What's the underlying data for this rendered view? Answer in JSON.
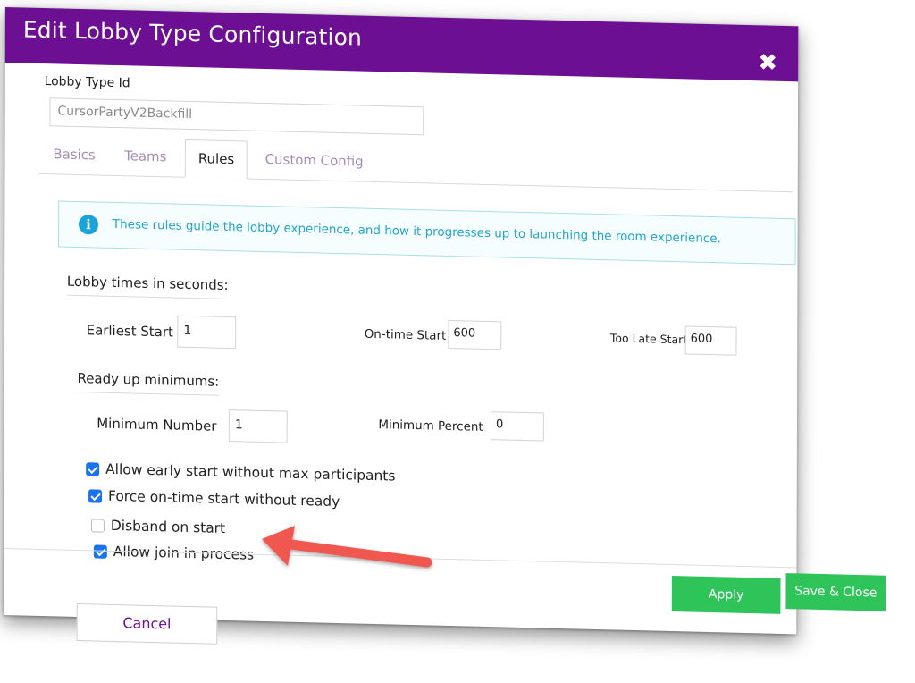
{
  "dialog": {
    "title": "Edit Lobby Type Configuration",
    "close_icon": "close-icon"
  },
  "lobby_type_id": {
    "label": "Lobby Type Id",
    "value": "CursorPartyV2Backfill"
  },
  "tabs": [
    {
      "label": "Basics",
      "active": false
    },
    {
      "label": "Teams",
      "active": false
    },
    {
      "label": "Rules",
      "active": true
    },
    {
      "label": "Custom Config",
      "active": false
    }
  ],
  "info": {
    "icon": "info-icon",
    "text": "These rules guide the lobby experience, and how it progresses up to launching the room experience."
  },
  "lobby_times": {
    "title": "Lobby times in seconds:",
    "earliest_start": {
      "label": "Earliest Start",
      "value": "1"
    },
    "on_time_start": {
      "label": "On-time Start",
      "value": "600"
    },
    "too_late_start": {
      "label": "Too Late Start",
      "value": "600"
    }
  },
  "ready_up": {
    "title": "Ready up minimums:",
    "minimum_number": {
      "label": "Minimum Number",
      "value": "1"
    },
    "minimum_percent": {
      "label": "Minimum Percent",
      "value": "0"
    }
  },
  "options": [
    {
      "label": "Allow early start without max participants",
      "checked": true
    },
    {
      "label": "Force on-time start without ready",
      "checked": true
    },
    {
      "label": "Disband on start",
      "checked": false
    },
    {
      "label": "Allow join in process",
      "checked": true
    }
  ],
  "buttons": {
    "apply": "Apply",
    "save_close": "Save & Close",
    "cancel": "Cancel"
  },
  "colors": {
    "title_bar": "#6d0f92",
    "accent_green": "#2fc45a",
    "info_text": "#22a6c9",
    "checkbox": "#1a73e8",
    "arrow": "#f0584f"
  }
}
